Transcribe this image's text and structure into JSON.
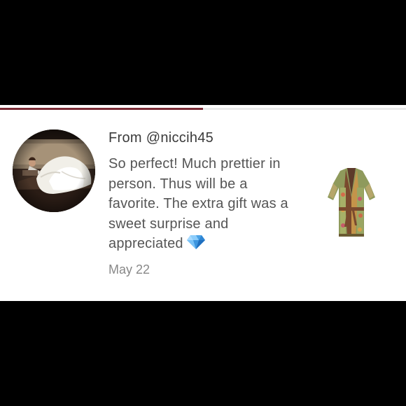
{
  "review": {
    "from": "From @niccih45",
    "text": "So perfect! Much prettier in person. Thus will be a favorite. The extra gift was a sweet surprise and appreciated",
    "date": "May 22",
    "emoji_icon": "gem-icon"
  },
  "progress": {
    "fraction": 0.5
  },
  "colors": {
    "progress_fill": "#7a2a35",
    "progress_track": "#e9e9e9",
    "background": "#000000",
    "card": "#ffffff"
  },
  "images": {
    "avatar": "reclining-woman-in-white-gown-photo",
    "product": "printed-kimono-robe-photo"
  }
}
